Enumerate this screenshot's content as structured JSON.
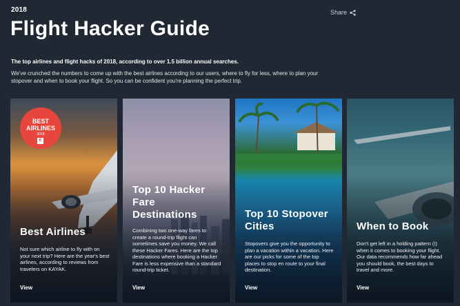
{
  "header": {
    "year": "2018",
    "share_label": "Share",
    "title": "Flight Hacker Guide",
    "lead": "The top airlines and flight hacks of 2018, according to over 1.5 billion annual searches.",
    "description": "We've crunched the numbers to come up with the best airlines according to our users, where to fly for less, where to plan your stopover and when to book your flight. So you can be confident you're planning the perfect trip."
  },
  "badge": {
    "line1": "BEST",
    "line2": "AIRLINES",
    "year": "2018",
    "mark": "K"
  },
  "cards": [
    {
      "title": "Best Airlines",
      "text": "Not sure which airline to fly with on your next trip? Here are the year's best airlines, according to reviews from travelers on KAYAK.",
      "view": "View"
    },
    {
      "title": "Top 10 Hacker Fare Destinations",
      "text": "Combining two one-way fares to create a round-trip flight can sometimes save you money. We call these Hacker Fares. Here are the top destinations where booking a Hacker Fare is less expensive than a standard round-trip ticket.",
      "view": "View"
    },
    {
      "title": "Top 10 Stopover Cities",
      "text": "Stopovers give you the opportunity to plan a vacation within a vacation. Here are our picks for some of the top places to stop en route to your final destination.",
      "view": "View"
    },
    {
      "title": "When to Book",
      "text": "Don't get left in a holding pattern (!) when it comes to booking your flight. Our data recommends how far ahead you should book, the best days to travel and more.",
      "view": "View"
    }
  ],
  "colors": {
    "background": "#1f2833",
    "badge": "#e8453c"
  }
}
